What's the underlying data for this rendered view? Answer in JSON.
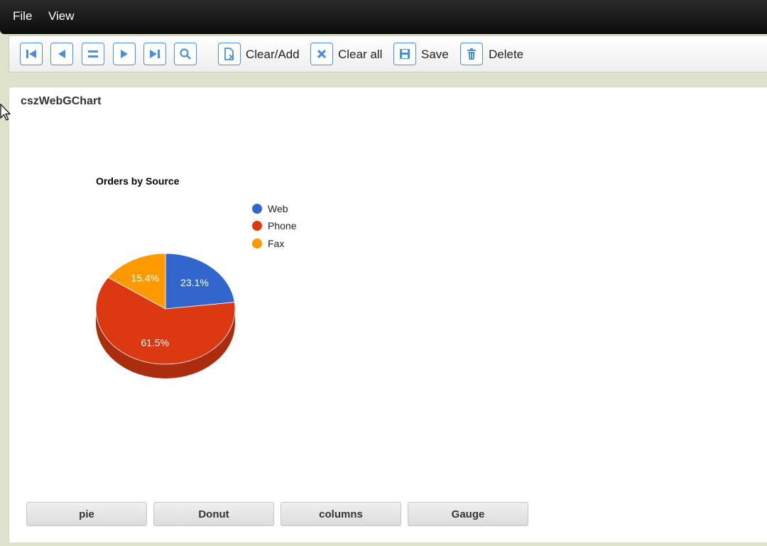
{
  "menu": {
    "file": "File",
    "view": "View"
  },
  "toolbar": {
    "nav_icons": [
      "first-record-icon",
      "previous-record-icon",
      "list-icon",
      "next-record-icon",
      "last-record-icon",
      "search-icon"
    ],
    "clear_add": "Clear/Add",
    "clear_all": "Clear all",
    "save": "Save",
    "delete": "Delete"
  },
  "panel": {
    "title": "cszWebGChart"
  },
  "colors": {
    "web": "#3366cc",
    "phone": "#dc3912",
    "fax": "#ff9900",
    "accent": "#4a90d9"
  },
  "chart_data": {
    "type": "pie",
    "title": "Orders by Source",
    "categories": [
      "Web",
      "Phone",
      "Fax"
    ],
    "values": [
      23.1,
      61.5,
      15.4
    ],
    "value_labels": [
      "23.1%",
      "61.5%",
      "15.4%"
    ],
    "colors": [
      "#3366cc",
      "#dc3912",
      "#ff9900"
    ],
    "legend_position": "right",
    "is3D": true
  },
  "chart_types": {
    "pie": "pie",
    "donut": "Donut",
    "columns": "columns",
    "gauge": "Gauge"
  }
}
